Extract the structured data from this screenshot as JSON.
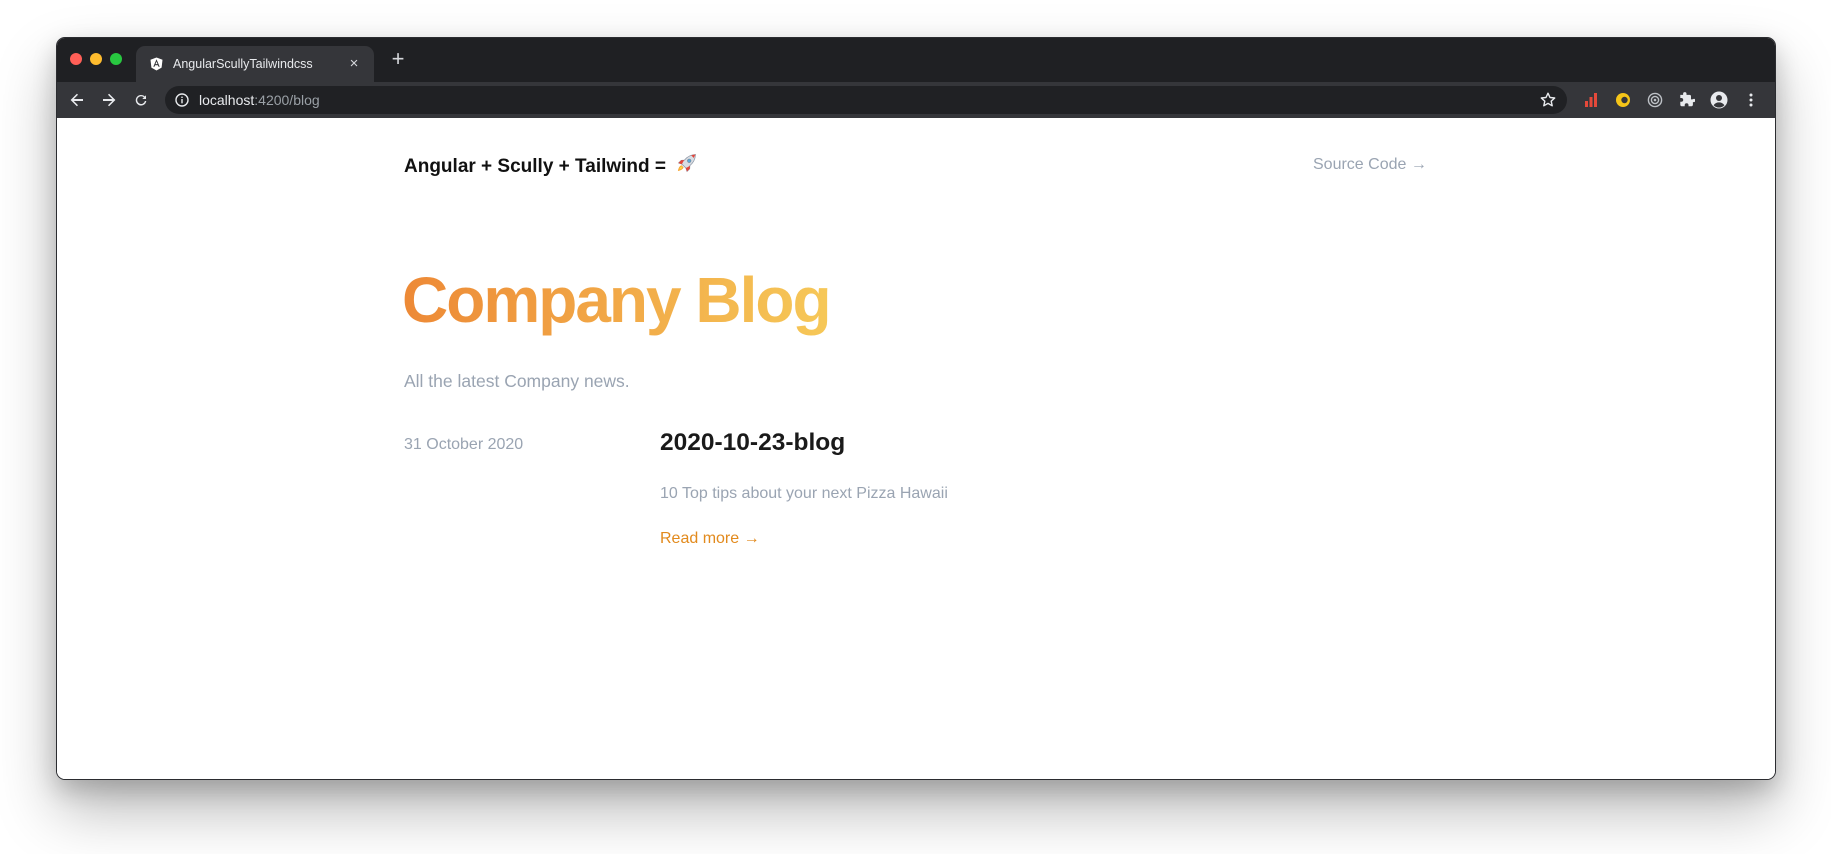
{
  "browser": {
    "tab": {
      "title": "AngularScullyTailwindcss",
      "close": "×",
      "favicon": "angular-icon"
    },
    "new_tab": "+",
    "address": {
      "host": "localhost",
      "path": ":4200/blog"
    },
    "icons": [
      "back-arrow-icon",
      "forward-arrow-icon",
      "reload-icon",
      "info-icon",
      "bookmark-star-icon",
      "bar-chart-extension-icon",
      "yellow-extension-icon",
      "target-extension-icon",
      "puzzle-extensions-icon",
      "profile-icon",
      "more-menu-icon"
    ]
  },
  "site": {
    "brand": "Angular + Scully + Tailwind =",
    "source_link": "Source Code →"
  },
  "blog": {
    "title": "Company Blog",
    "subtitle": "All the latest Company news."
  },
  "posts": [
    {
      "date": "31 October 2020",
      "title": "2020-10-23-blog",
      "description": "10 Top tips about your next Pizza Hawaii",
      "read_more": "Read more →"
    }
  ],
  "colors": {
    "title_gradient_start": "#ed8936",
    "title_gradient_end": "#f6c858",
    "link_orange": "#e28a1d",
    "muted_text": "#9aa4b2",
    "chrome_dark": "#1f2023"
  }
}
